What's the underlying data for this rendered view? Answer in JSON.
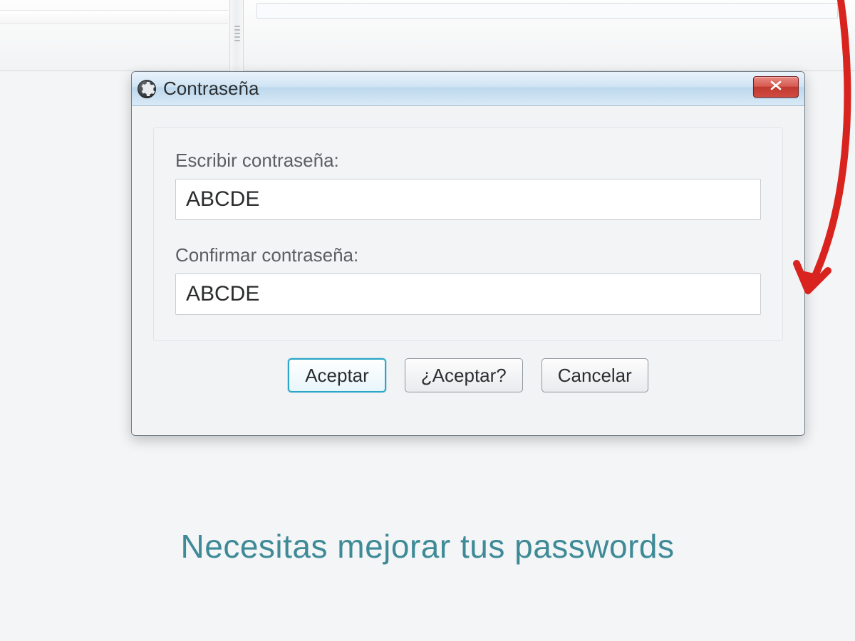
{
  "dialog": {
    "title": "Contraseña",
    "fields": {
      "password_label": "Escribir contraseña:",
      "password_value": "ABCDE",
      "confirm_label": "Confirmar contraseña:",
      "confirm_value": "ABCDE"
    },
    "buttons": {
      "accept": "Aceptar",
      "accept_q": "¿Aceptar?",
      "cancel": "Cancelar"
    }
  },
  "caption": "Necesitas mejorar tus passwords"
}
